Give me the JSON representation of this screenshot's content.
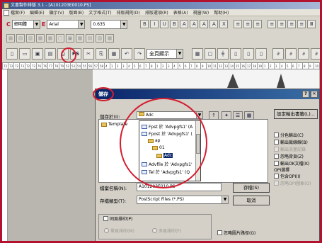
{
  "window": {
    "title": "文書製作排版 3.1 - [A101203E0010.PS]"
  },
  "menu": [
    "檔案(F)",
    "編輯(E)",
    "顯示(V)",
    "版面(B)",
    "文字格式(T)",
    "排版規則(D)",
    "排版選項(R)",
    "表格(A)",
    "視窗(W)",
    "幫助(H)"
  ],
  "toolbar": {
    "c_label": "C",
    "chinese_font": "細明體",
    "e_label": "E",
    "english_font": "Arial",
    "size_value": "0.635",
    "format_buttons": [
      "B",
      "I",
      "U",
      "B",
      "A",
      "A",
      "A",
      "A",
      "X"
    ],
    "ps_button": "PS",
    "zoom": "全頁顯示"
  },
  "ruler": [
    "72",
    "73",
    "72",
    "73",
    "72",
    "73",
    "76",
    "76",
    "77",
    "78",
    "79",
    "52",
    "53",
    "54",
    "55",
    "56",
    "57",
    "58",
    "4",
    "1",
    "2",
    "3",
    "4",
    "5",
    "6",
    "7",
    "8",
    "1",
    "2",
    "3",
    "4",
    "5",
    "6",
    "7",
    "8",
    "9",
    "10",
    "11",
    "12",
    "13",
    "14",
    "15",
    "16",
    "17",
    "18",
    "19",
    "1",
    "2",
    "3",
    "4",
    "5",
    "6",
    "7",
    "8",
    "9",
    "10",
    "11",
    "12",
    "13",
    "14",
    "15",
    "16"
  ],
  "dialog": {
    "title": "儲存",
    "save_in_label": "儲存於(I):",
    "save_in_value": "Adc",
    "set_bookmarks_button": "設定輸出書籤(L)...",
    "files": [
      {
        "name": "Template",
        "type": "folder"
      }
    ],
    "dropdown_items": [
      {
        "name": "Fpst 於 'Advpgfs1' (A",
        "type": "net"
      },
      {
        "name": "Fpost 於 'Advpgfs1' (",
        "type": "net"
      },
      {
        "name": "ap",
        "type": "folder"
      },
      {
        "name": "01",
        "type": "folder"
      },
      {
        "name": "Adc",
        "type": "folder",
        "selected": true
      },
      {
        "name": "Advfile 於 'Advpgfs1'",
        "type": "net"
      },
      {
        "name": "Tel 於 'Advpgfs1' (Q",
        "type": "net"
      }
    ],
    "filename_label": "檔案名稱(N):",
    "filename_value": "A101203E010.PS",
    "save_button": "存檔(S)",
    "filetype_label": "存檔類型(T):",
    "filetype_value": "PostScript Files (*.PS)",
    "cancel_button": "取消",
    "options": [
      {
        "label": "分色輸出(C)",
        "enabled": true
      },
      {
        "label": "輸出裁線線(B)",
        "enabled": true
      },
      {
        "label": "輸出流量記錄",
        "enabled": false
      },
      {
        "label": "忽略背頁(Z)",
        "enabled": true
      },
      {
        "label": "輸出OK文檔(K)",
        "enabled": true
      }
    ],
    "opi_group_label": "OPI選擇",
    "opi_options": [
      {
        "label": "包含OPI(I)",
        "enabled": true
      },
      {
        "label": "忽略OPI圖象(O)",
        "enabled": false
      }
    ],
    "sync_label": "同頁排印(P)",
    "radio_1": "單頁排印(M)",
    "radio_2": "多頁排印(F)",
    "ignore_path_label": "忽略圖片路徑(G)"
  }
}
